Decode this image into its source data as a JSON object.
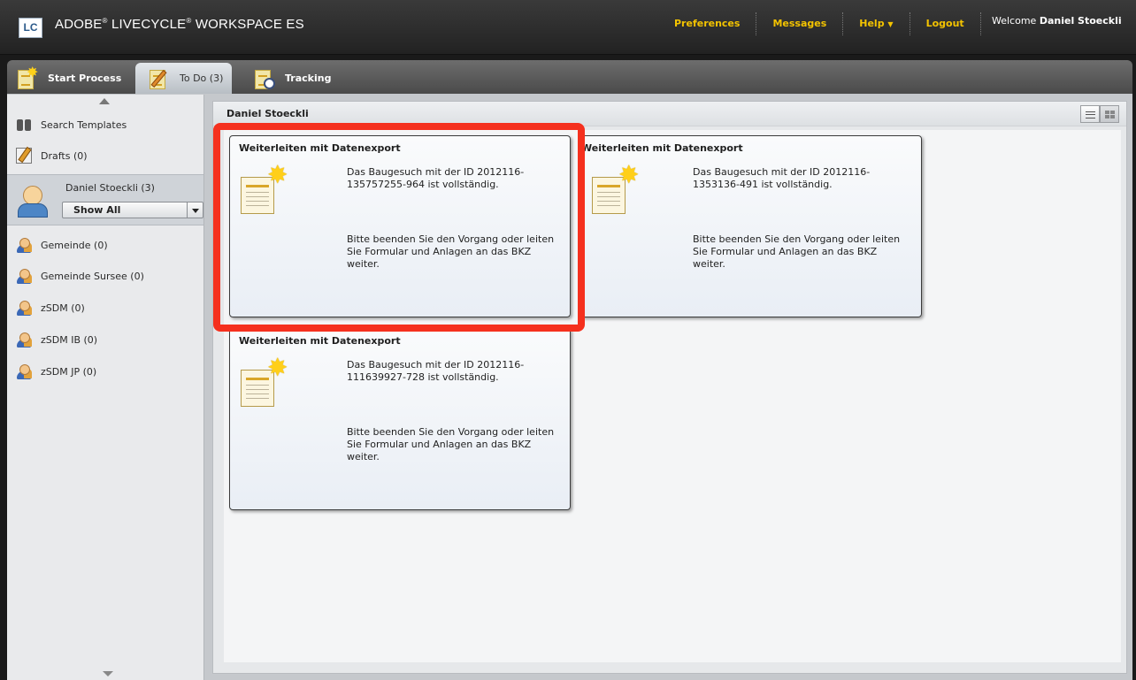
{
  "app": {
    "logo_text": "LC",
    "title_brand": "ADOBE",
    "title_product": "LIVECYCLE",
    "title_suffix": "WORKSPACE ES"
  },
  "header": {
    "links": [
      "Preferences",
      "Messages",
      "Help",
      "Logout"
    ],
    "welcome_prefix": "Welcome",
    "user_name": "Daniel Stoeckli"
  },
  "tabs": [
    {
      "label": "Start Process",
      "active": false
    },
    {
      "label": "To Do (3)",
      "active": true
    },
    {
      "label": "Tracking",
      "active": false
    }
  ],
  "sidebar": {
    "search_templates": "Search Templates",
    "drafts": "Drafts (0)",
    "queue_owner": "Daniel Stoeckli (3)",
    "filter_selected": "Show All",
    "queues": [
      "Gemeinde (0)",
      "Gemeinde Sursee (0)",
      "zSDM (0)",
      "zSDM IB (0)",
      "zSDM JP (0)"
    ]
  },
  "content": {
    "header": "Daniel Stoeckli",
    "tasks": [
      {
        "title": "Weiterleiten mit Datenexport",
        "text1": "Das Baugesuch mit der ID 2012116-135757255-964 ist vollständig.",
        "text2": "Bitte beenden Sie den Vorgang oder leiten Sie Formular und Anlagen an das BKZ weiter."
      },
      {
        "title": "Weiterleiten mit Datenexport",
        "text1": "Das Baugesuch mit der ID 2012116-1353136-491 ist vollständig.",
        "text2": "Bitte beenden Sie den Vorgang oder leiten Sie Formular und Anlagen an das BKZ weiter."
      },
      {
        "title": "Weiterleiten mit Datenexport",
        "text1": "Das Baugesuch mit der ID 2012116-111639927-728 ist vollständig.",
        "text2": "Bitte beenden Sie den Vorgang oder leiten Sie Formular und Anlagen an das BKZ weiter."
      }
    ]
  },
  "colors": {
    "accent_links": "#f3c300",
    "highlight": "#f5301e"
  }
}
